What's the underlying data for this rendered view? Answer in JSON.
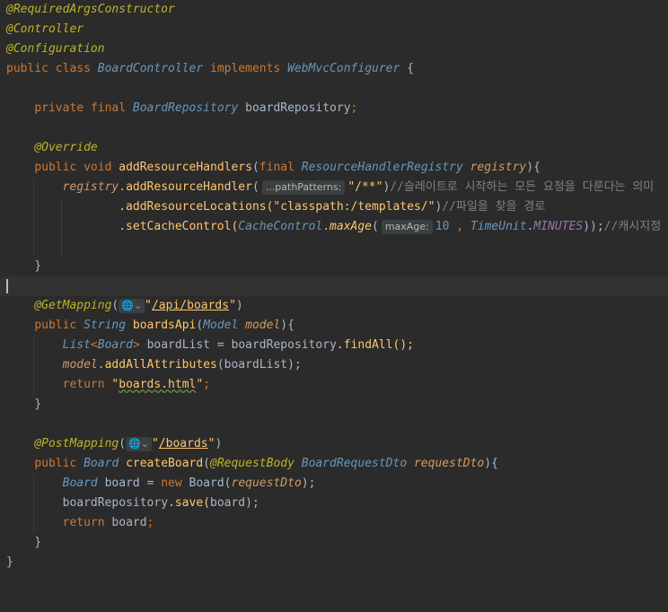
{
  "editor": {
    "tokens": {
      "a_req": "@RequiredArgsConstructor",
      "a_ctrl": "@Controller",
      "a_conf": "@Configuration",
      "k_public": "public",
      "k_class": "class",
      "c_board_controller": "BoardController",
      "k_implements": "implements",
      "c_webmvc": "WebMvcConfigurer",
      "brace_open": "{",
      "brace_close": "}",
      "k_private": "private",
      "k_final": "final",
      "c_board_repo": "BoardRepository",
      "f_board_repo": "boardRepository",
      "semi": ";",
      "a_override": "@Override",
      "k_void": "void",
      "m_add_handlers": "addResourceHandlers",
      "paren_open": "(",
      "paren_close": ")",
      "c_handler_registry": "ResourceHandlerRegistry",
      "p_registry": "registry",
      "dot": ".",
      "m_add_handler": "addResourceHandler",
      "hint_path_patterns": "...pathPatterns:",
      "s_path": "\"/**\"",
      "cmt_handler": "//슬레이트로 시작하는 모든 요청을 다룬다는 의미",
      "m_add_locations": ".addResourceLocations(",
      "s_classpath": "\"classpath:/templates/\"",
      "cmt_locations": "//파일을 찾을 경로",
      "m_set_cache": ".setCacheControl(",
      "c_cache_control": "CacheControl",
      "m_max_age": "maxAge",
      "hint_max_age": "maxAge:",
      "n_ten": "10",
      "comma": ",",
      "c_time_unit": "TimeUnit",
      "const_minutes": "MINUTES",
      "close_chain": "));",
      "cmt_cache": "//캐시지정",
      "a_get_mapping": "@GetMapping",
      "globe_icon": "🌐⌄",
      "s_api_boards_q1": "\"",
      "s_api_boards": "/api/boards",
      "s_api_boards_q2": "\"",
      "k_string": "String",
      "m_boards_api": "boardsApi",
      "c_model": "Model",
      "p_model": "model",
      "c_list": "List",
      "lt": "<",
      "c_board": "Board",
      "gt": ">",
      "v_board_list": "boardList",
      "eq": "=",
      "m_find_all": ".findAll();",
      "m_add_all": "addAllAttributes",
      "k_return": "return",
      "s_boards_html_q1": "\"",
      "s_boards_html": "boards.html",
      "s_boards_html_q2": "\"",
      "a_post_mapping": "@PostMapping",
      "s_boards_path": "/boards",
      "m_create_board": "createBoard",
      "a_request_body": "@RequestBody",
      "c_board_request_dto": "BoardRequestDto",
      "p_request_dto": "requestDto",
      "v_board": "board",
      "k_new": "new",
      "m_save": ".save(",
      "close_semi": ");"
    }
  }
}
